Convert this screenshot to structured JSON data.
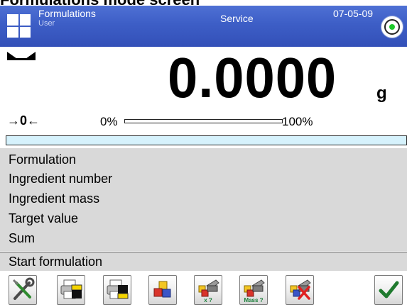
{
  "page_heading": "Formulations mode screen",
  "header": {
    "title": "Formulations",
    "user": "User",
    "mode": "Service",
    "date": "07-05-09",
    "colors": {
      "header_blue": "#3d5ec6",
      "status_green": "#1ec92a"
    }
  },
  "display": {
    "reading": "0.0000",
    "unit": "g",
    "zero_symbol": "→0←",
    "bargraph": {
      "start_label": "0%",
      "end_label": "100%",
      "value_fraction": 0
    },
    "progress_strip_color": "#d6f2fc"
  },
  "info_rows": [
    {
      "label": "Formulation"
    },
    {
      "label": "Ingredient number"
    },
    {
      "label": "Ingredient mass"
    },
    {
      "label": "Target value"
    },
    {
      "label": "Sum"
    }
  ],
  "function_bar": {
    "label": "Start formulation"
  },
  "toolbar": {
    "buttons": [
      {
        "icon": "tools-icon"
      },
      {
        "icon": "printer-header-icon"
      },
      {
        "icon": "printer-footer-icon"
      },
      {
        "icon": "ingredients-icon"
      },
      {
        "icon": "ingredient-count-icon",
        "caption": "x ?"
      },
      {
        "icon": "ingredient-mass-icon",
        "caption": "Mass ?"
      },
      {
        "icon": "ingredients-delete-icon"
      },
      {
        "icon": "checkmark-icon"
      }
    ]
  }
}
